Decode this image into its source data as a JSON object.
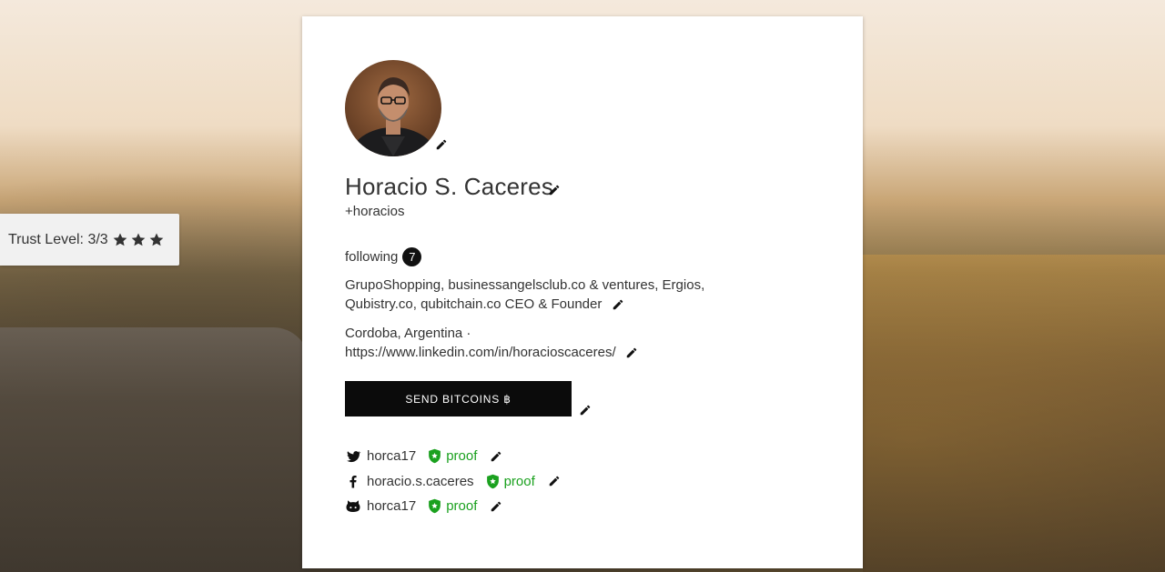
{
  "trust": {
    "label": "Trust Level: 3/3",
    "star_count": 3
  },
  "profile": {
    "name": "Horacio S. Caceres",
    "handle": "+horacios",
    "following_label": "following",
    "following_count": "7",
    "bio": "GrupoShopping, businessangelsclub.co & ventures, Ergios, Qubistry.co, qubitchain.co CEO & Founder",
    "location": "Cordoba, Argentina ·",
    "website": "https://www.linkedin.com/in/horacioscaceres/"
  },
  "send_button": {
    "label": "SEND BITCOINS ฿"
  },
  "proofs": [
    {
      "service": "twitter",
      "icon": "twitter-icon",
      "username": "horca17",
      "status": "proof"
    },
    {
      "service": "facebook",
      "icon": "facebook-icon",
      "username": "horacio.s.caceres",
      "status": "proof"
    },
    {
      "service": "github",
      "icon": "github-icon",
      "username": "horca17",
      "status": "proof"
    }
  ],
  "colors": {
    "proof_green": "#1ba11f",
    "button_black": "#0b0b0b",
    "text": "#333333"
  }
}
